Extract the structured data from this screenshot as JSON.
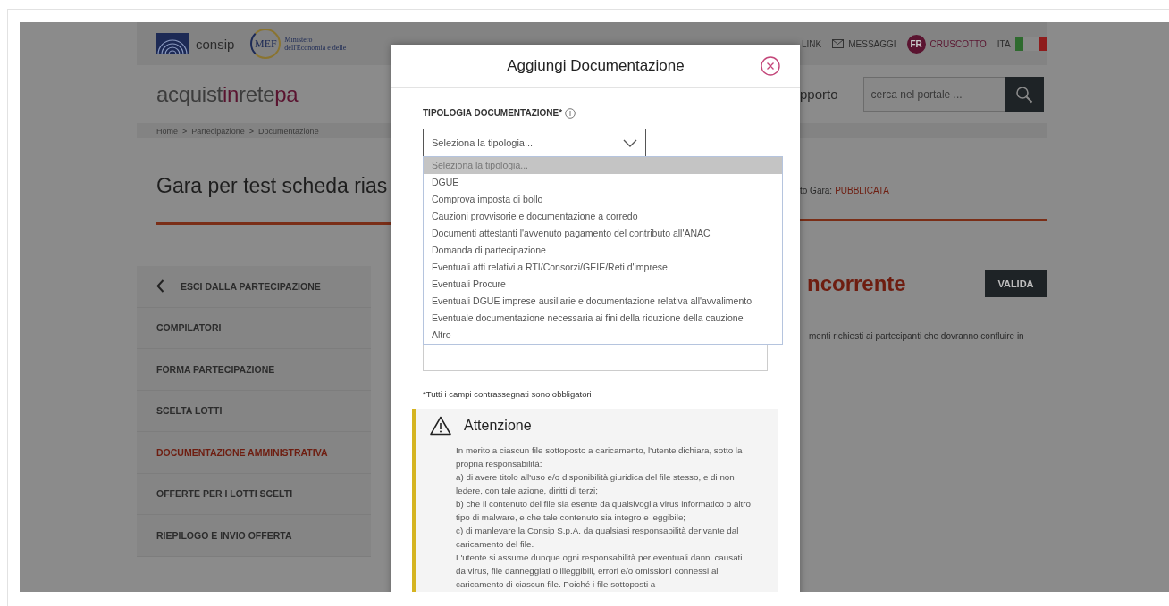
{
  "header": {
    "consip_logo": "consip",
    "mef_logo": {
      "mark": "MEF",
      "line_1": "Ministero",
      "line_2": "dell'Economia e delle"
    },
    "links": [
      {
        "kind": "text",
        "label": "LINK"
      },
      {
        "kind": "mail",
        "label": "MESSAGGI"
      },
      {
        "kind": "avatar",
        "initials": "FR",
        "label": "CRUSCOTTO"
      },
      {
        "kind": "language",
        "label": "ITA"
      }
    ]
  },
  "brand": [
    {
      "text": "acquist",
      "accent": false
    },
    {
      "text": "in",
      "accent": true
    },
    {
      "text": "rete",
      "accent": false
    },
    {
      "text": "pa",
      "accent": true
    }
  ],
  "nav_fragment": "pporto",
  "search": {
    "placeholder": "cerca nel portale ..."
  },
  "breadcrumb": {
    "separator": ">",
    "items": [
      "Home",
      "Partecipazione",
      "Documentazione"
    ]
  },
  "page": {
    "title": "Gara per test scheda rias",
    "status_label": "to Gara:",
    "status_value": "PUBBLICATA"
  },
  "sidebar": {
    "back": "ESCI DALLA PARTECIPAZIONE",
    "items": [
      {
        "label": "COMPILATORI",
        "selected": false
      },
      {
        "label": "FORMA PARTECIPAZIONE",
        "selected": false
      },
      {
        "label": "SCELTA LOTTI",
        "selected": false
      },
      {
        "label": "DOCUMENTAZIONE AMMINISTRATIVA",
        "selected": true
      },
      {
        "label": "OFFERTE PER I LOTTI SCELTI",
        "selected": false
      },
      {
        "label": "RIEPILOGO E INVIO OFFERTA",
        "selected": false
      }
    ]
  },
  "content": {
    "heading": "ncorrente",
    "button": "VALIDA",
    "text": "menti richiesti ai partecipanti che dovranno confluire in"
  },
  "modal": {
    "title": "Aggiungi Documentazione",
    "field_label": "TIPOLOGIA DOCUMENTAZIONE*",
    "select_value": "Seleziona la tipologia...",
    "options": [
      {
        "label": "Seleziona la tipologia...",
        "selected": true
      },
      {
        "label": "DGUE",
        "selected": false
      },
      {
        "label": "Comprova imposta di bollo",
        "selected": false
      },
      {
        "label": "Cauzioni provvisorie e documentazione a corredo",
        "selected": false
      },
      {
        "label": "Documenti attestanti l'avvenuto pagamento del contributo all'ANAC",
        "selected": false
      },
      {
        "label": "Domanda di partecipazione",
        "selected": false
      },
      {
        "label": "Eventuali atti relativi a RTI/Consorzi/GEIE/Reti d'imprese",
        "selected": false
      },
      {
        "label": "Eventuali Procure",
        "selected": false
      },
      {
        "label": "Eventuali DGUE imprese ausiliarie e documentazione relativa all'avvalimento",
        "selected": false
      },
      {
        "label": "Eventuale documentazione necessaria ai fini della riduzione della cauzione",
        "selected": false
      },
      {
        "label": "Altro",
        "selected": false
      }
    ],
    "required_note": "*Tutti i campi contrassegnati sono obbligatori",
    "alert": {
      "title": "Attenzione",
      "paragraphs": [
        "In merito a ciascun file sottoposto a caricamento, l'utente dichiara, sotto la propria responsabilità:",
        "a) di avere titolo all'uso e/o disponibilità giuridica del file stesso, e di non ledere, con tale azione, diritti di terzi;",
        "b) che il contenuto del file sia esente da qualsivoglia virus informatico o altro tipo di malware, e che tale contenuto sia integro e leggibile;",
        "c) di manlevare la Consip S.p.A. da qualsiasi responsabilità derivante dal caricamento del file.",
        "L'utente si assume dunque ogni responsabilità per eventuali danni causati da virus, file danneggiati o illeggibili, errori e/o omissioni connessi al caricamento di ciascun file. Poiché i file sottoposti a"
      ]
    }
  }
}
